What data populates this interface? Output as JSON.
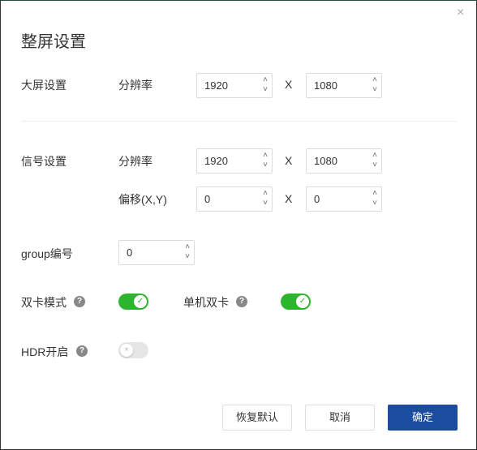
{
  "dialog": {
    "title": "整屏设置",
    "close_icon": "×"
  },
  "screen": {
    "label": "大屏设置",
    "resolution_label": "分辨率",
    "width": "1920",
    "height": "1080",
    "x_sep": "X"
  },
  "signal": {
    "label": "信号设置",
    "resolution_label": "分辨率",
    "width": "1920",
    "height": "1080",
    "offset_label": "偏移(X,Y)",
    "offset_x": "0",
    "offset_y": "0",
    "x_sep": "X"
  },
  "group": {
    "label": "group编号",
    "value": "0"
  },
  "dual_card": {
    "label": "双卡模式",
    "on": true
  },
  "single_dual": {
    "label": "单机双卡",
    "on": true
  },
  "hdr": {
    "label": "HDR开启",
    "on": false
  },
  "help": "?",
  "spin_up": "˄",
  "spin_down": "˅",
  "check": "✓",
  "cross": "×",
  "buttons": {
    "reset": "恢复默认",
    "cancel": "取消",
    "ok": "确定"
  },
  "colors": {
    "accent": "#1a4ca0",
    "switch_on": "#2db52d"
  }
}
